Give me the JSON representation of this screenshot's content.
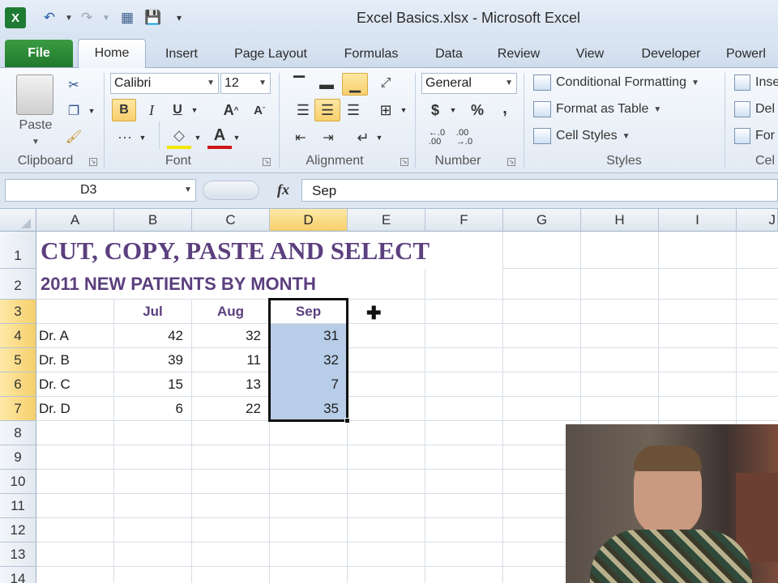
{
  "window": {
    "title": "Excel Basics.xlsx  -  Microsoft Excel"
  },
  "tabs": [
    "File",
    "Home",
    "Insert",
    "Page Layout",
    "Formulas",
    "Data",
    "Review",
    "View",
    "Developer",
    "Powerl"
  ],
  "clipboard": {
    "paste_label": "Paste",
    "group_label": "Clipboard"
  },
  "font": {
    "name": "Calibri",
    "size": "12",
    "group_label": "Font",
    "bold": "B",
    "italic": "I",
    "underline": "U"
  },
  "alignment": {
    "group_label": "Alignment"
  },
  "number": {
    "format": "General",
    "currency": "$",
    "percent": "%",
    "comma": ",",
    "group_label": "Number"
  },
  "styles": {
    "conditional": "Conditional Formatting",
    "format_table": "Format as Table",
    "cell_styles": "Cell Styles",
    "group_label": "Styles"
  },
  "cells_group": {
    "insert": "Inse",
    "delete": "Del",
    "format": "For",
    "group_label": "Cel"
  },
  "formula_bar": {
    "name_box": "D3",
    "fx": "fx",
    "value": "Sep"
  },
  "columns": [
    "A",
    "B",
    "C",
    "D",
    "E",
    "F",
    "G",
    "H",
    "I",
    "J"
  ],
  "rows": [
    "1",
    "2",
    "3",
    "4",
    "5",
    "6",
    "7",
    "8",
    "9",
    "10",
    "11",
    "12",
    "13",
    "14"
  ],
  "sheet": {
    "title": "CUT, COPY, PASTE AND SELECT",
    "subtitle": "2011 NEW PATIENTS BY MONTH",
    "headers": [
      "Jul",
      "Aug",
      "Sep"
    ],
    "table": [
      {
        "name": "Dr. A",
        "jul": "42",
        "aug": "32",
        "sep": "31"
      },
      {
        "name": "Dr. B",
        "jul": "39",
        "aug": "11",
        "sep": "32"
      },
      {
        "name": "Dr. C",
        "jul": "15",
        "aug": "13",
        "sep": "7"
      },
      {
        "name": "Dr. D",
        "jul": "6",
        "aug": "22",
        "sep": "35"
      }
    ]
  },
  "colors": {
    "accent": "#5b3f7e",
    "selection": "#b8cde8",
    "active_header": "#f6cf6c",
    "file_tab": "#2e8b38"
  }
}
